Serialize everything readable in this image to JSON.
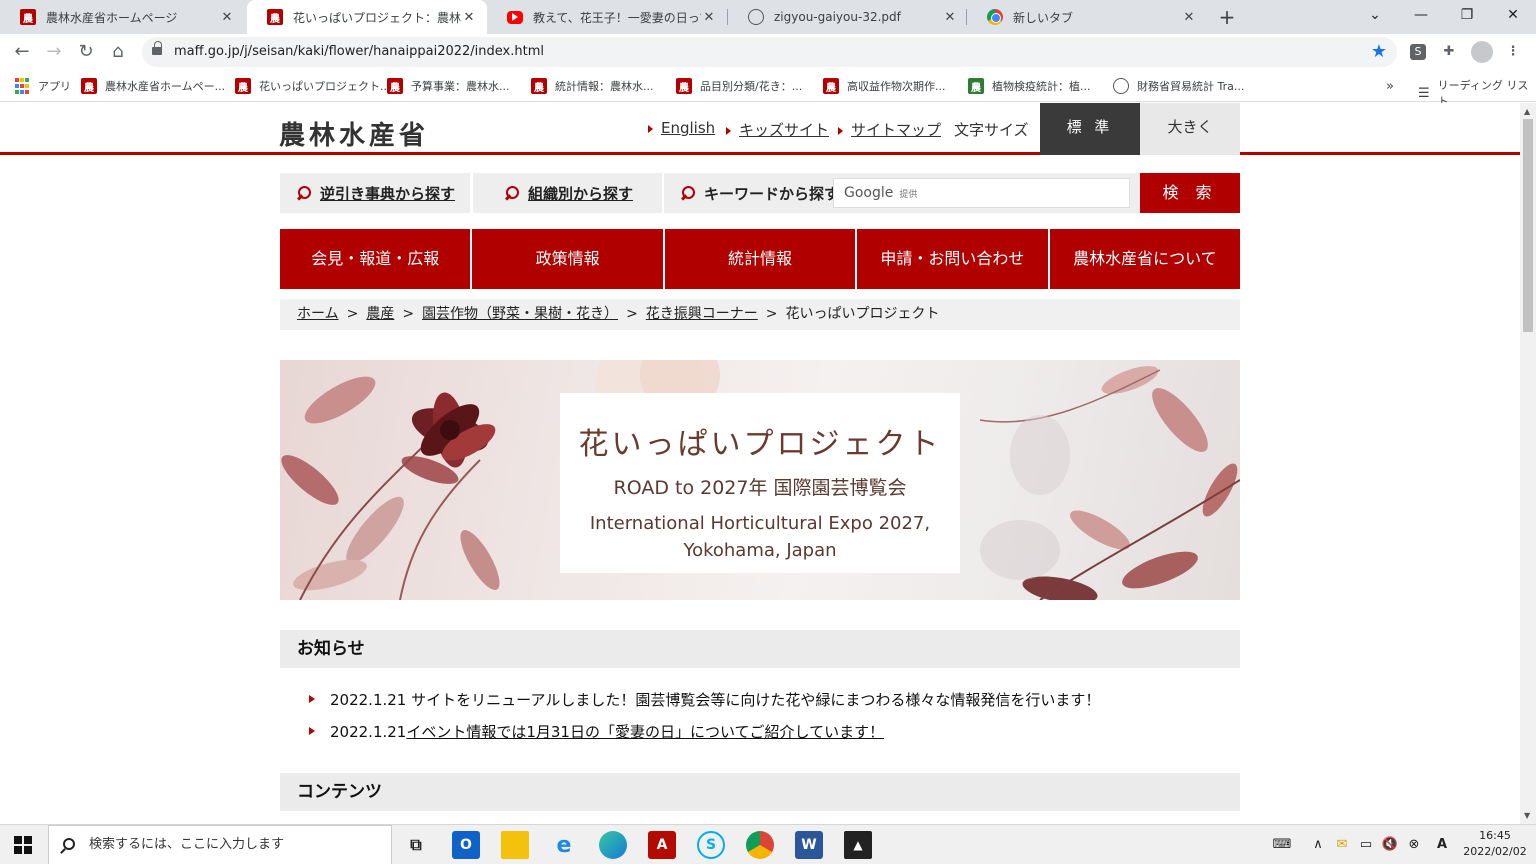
{
  "browser": {
    "tabs": [
      {
        "title": "農林水産省ホームページ",
        "favicon": "maff-icon"
      },
      {
        "title": "花いっぱいプロジェクト：農林水産省",
        "favicon": "maff-icon",
        "active": true
      },
      {
        "title": "教えて、花王子！一愛妻の日って、何？",
        "favicon": "youtube-icon"
      },
      {
        "title": "zigyou-gaiyou-32.pdf",
        "favicon": "globe-icon"
      },
      {
        "title": "新しいタブ",
        "favicon": "chrome-icon"
      }
    ],
    "url": "maff.go.jp/j/seisan/kaki/flower/hanaippai2022/index.html",
    "bookmarks": [
      {
        "label": "アプリ"
      },
      {
        "label": "農林水産省ホームペー..."
      },
      {
        "label": "花いっぱいプロジェクト..."
      },
      {
        "label": "予算事業：農林水..."
      },
      {
        "label": "統計情報：農林水..."
      },
      {
        "label": "品目別分類/花き：..."
      },
      {
        "label": "高収益作物次期作..."
      },
      {
        "label": "植物検疫統計：植..."
      },
      {
        "label": "財務省貿易統計 Tra..."
      }
    ],
    "bookmarks_more": "»",
    "reading_list": "リーディング リスト"
  },
  "site": {
    "logo": "農林水産省",
    "header_links": [
      "English",
      "キッズサイト",
      "サイトマップ"
    ],
    "font_size_label": "文字サイズ",
    "font_size_standard": "標 準",
    "font_size_large": "大きく",
    "search": {
      "reverse_index": "逆引き事典から探す",
      "by_org": "組織別から探す",
      "keyword": "キーワードから探す",
      "google_placeholder": "Google",
      "google_suffix": "提供",
      "button": "検 索"
    },
    "global_nav": [
      "会見・報道・広報",
      "政策情報",
      "統計情報",
      "申請・お問い合わせ",
      "農林水産省について"
    ],
    "breadcrumb": {
      "links": [
        "ホーム",
        "農産",
        "園芸作物（野菜・果樹・花き）",
        "花き振興コーナー"
      ],
      "current": "花いっぱいプロジェクト"
    },
    "hero": {
      "title": "花いっぱいプロジェクト",
      "subtitle": "ROAD to 2027年 国際園芸博覧会",
      "english_1": "International Horticultural Expo 2027,",
      "english_2": "Yokohama, Japan"
    },
    "news": {
      "heading": "お知らせ",
      "items": [
        {
          "date": "2022.1.21",
          "text": " サイトをリニューアルしました！園芸博覧会等に向けた花や緑にまつわる様々な情報発信を行います！"
        },
        {
          "date": "2022.1.21",
          "link": "イベント情報では1月31日の「愛妻の日」についてご紹介しています！"
        }
      ]
    },
    "contents_heading": "コンテンツ"
  },
  "taskbar": {
    "search_placeholder": "検索するには、ここに入力します",
    "time": "16:45",
    "date": "2022/02/02",
    "apps": [
      "task-view",
      "outlook",
      "file-explorer",
      "internet-explorer",
      "edge",
      "acrobat",
      "skype",
      "chrome",
      "word",
      "photos"
    ]
  },
  "colors": {
    "brand_red": "#b00000",
    "dark": "#3a3a3a",
    "light_gray": "#eeeeee"
  }
}
